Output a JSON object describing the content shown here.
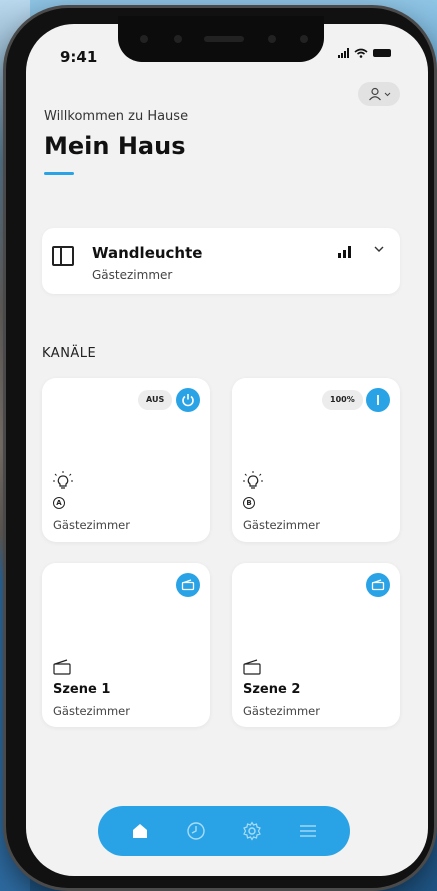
{
  "status_bar": {
    "time": "9:41"
  },
  "header": {
    "welcome": "Willkommen zu Hause",
    "title": "Mein Haus"
  },
  "device": {
    "name": "Wandleuchte",
    "room": "Gästezimmer"
  },
  "channels": {
    "label": "KANÄLE",
    "items": [
      {
        "state": "AUS",
        "letter": "A",
        "room": "Gästezimmer"
      },
      {
        "state": "100%",
        "letter": "B",
        "room": "Gästezimmer"
      }
    ]
  },
  "scenes": [
    {
      "name": "Szene 1",
      "room": "Gästezimmer"
    },
    {
      "name": "Szene 2",
      "room": "Gästezimmer"
    }
  ],
  "nav": {
    "items": [
      "home-icon",
      "clock-icon",
      "gear-icon",
      "menu-icon"
    ]
  },
  "colors": {
    "accent": "#2aa3e6",
    "screen_bg": "#f2f2f2",
    "card_bg": "#ffffff"
  }
}
